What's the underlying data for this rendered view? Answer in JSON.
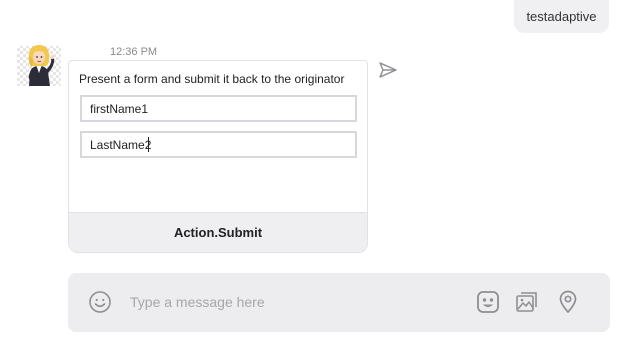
{
  "outgoing_message": {
    "text": "testadaptive"
  },
  "bot_message": {
    "timestamp": "12:36 PM",
    "avatar_icon": "bot-avatar-icon",
    "card": {
      "text": "Present a form and submit it back to the originator",
      "inputs": [
        {
          "value": "firstName1"
        },
        {
          "value": "LastName2"
        }
      ],
      "action_label": "Action.Submit"
    },
    "send_icon": "send-icon"
  },
  "composer": {
    "placeholder": "Type a message here",
    "icons": [
      "emoji-icon",
      "sticker-icon",
      "gallery-icon",
      "location-icon"
    ]
  },
  "colors": {
    "bubble_bg": "#f0f0f3",
    "composer_bg": "#ededf0",
    "icon_gray": "#8e8e93"
  }
}
